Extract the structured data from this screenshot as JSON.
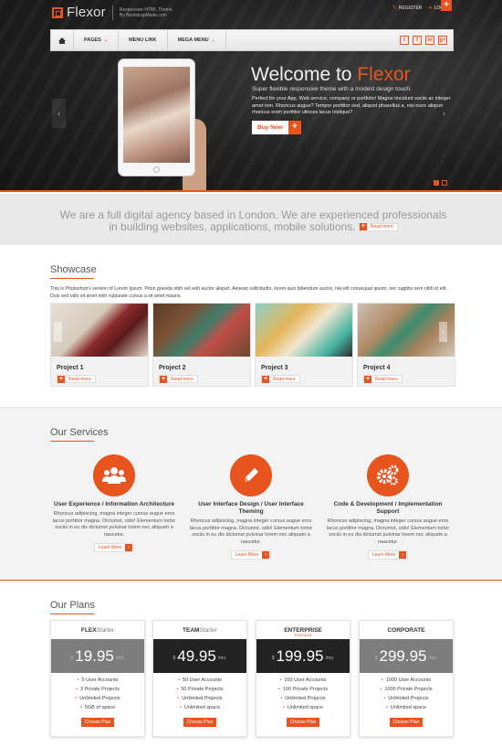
{
  "brand": {
    "name": "Flexor",
    "tagline_1": "Responsive HTML Theme",
    "tagline_2": "By BootstrapMade.com",
    "accent": "#e8541e"
  },
  "top_links": {
    "register": "REGISTER",
    "login": "LOGIN",
    "plus": "+"
  },
  "nav": {
    "items": [
      {
        "label": "PAGES",
        "has_caret": true
      },
      {
        "label": "MENU LINK",
        "has_caret": false
      },
      {
        "label": "MEGA MENU",
        "has_caret": true
      }
    ],
    "social": [
      "t",
      "f",
      "in",
      "g+"
    ]
  },
  "hero": {
    "title_prefix": "Welcome to ",
    "title_accent": "Flexor",
    "subtitle": "Super flexible responsive theme with a modest design touch.",
    "text": "Perfect for your App, Web service, company or portfolio! Magna tincidunt sociis ac integer amet non. Rhoncus augue? Tempor porttitor sed, aliquet phasellus a, nisi nunc aliquet rhoncus enim porttitor ultrices lacus tristique?",
    "button": "Buy Now",
    "button_plus": "+",
    "prev": "‹",
    "next": "›"
  },
  "band": {
    "text": "We are a full digital agency based in London. We are experienced professionals in building websites, applications, mobile solutions.",
    "read_more": "Read more"
  },
  "showcase": {
    "title": "Showcase",
    "text": "This is Photoshop's version of Lorem Ipsum. Proin gravida nibh vel velit auctor aliquet. Aenean sollicitudin, lorem quis bibendum auctor, nisi elit consequat ipsum, nec sagittis sem nibh id elit. Duis sed odio sit amet nibh vulputate cursus a sit amet mauris.",
    "projects": [
      {
        "name": "Project 1",
        "read_more": "Read more"
      },
      {
        "name": "Project 2",
        "read_more": "Read more"
      },
      {
        "name": "Project 3",
        "read_more": "Read more"
      },
      {
        "name": "Project 4",
        "read_more": "Read more"
      }
    ]
  },
  "services": {
    "title": "Our Services",
    "items": [
      {
        "title": "User Experience / Information Architecture",
        "text": "Rhoncus adipiscing, magna integer cursus augue eros lacus porttitor magna. Dictumst, odio! Elementum tortor sociis in eu dis dictumst pulvinar lorem nec aliquam a nascetur.",
        "button": "Learn More",
        "icon": "users-icon"
      },
      {
        "title": "User Interface Design / User Interface Theming",
        "text": "Rhoncus adipiscing, magna integer cursus augue eros lacus porttitor magna. Dictumst, odio! Elementum tortor sociis in eu dis dictumst pulvinar lorem nec aliquam a nascetur.",
        "button": "Learn More",
        "icon": "pencil-icon"
      },
      {
        "title": "Code & Development / Implementation Support",
        "text": "Rhoncus adipiscing, magna integer cursus augue eros lacus porttitor magna. Dictumst, odio! Elementum tortor sociis in eu dis dictumst pulvinar lorem nec aliquam a nascetur.",
        "button": "Learn More",
        "icon": "gears-icon"
      }
    ]
  },
  "plans": {
    "title": "Our Plans",
    "items": [
      {
        "name": "FLEX",
        "suffix": "Starter",
        "popular": "",
        "currency": "$",
        "price": "19.95",
        "per": "/mo.",
        "features": [
          "5 User Accounts",
          "3 Private Projects",
          "Unlimited Projects",
          "5GB of space"
        ],
        "button": "Choose Plan"
      },
      {
        "name": "TEAM",
        "suffix": "Starter",
        "popular": "",
        "currency": "$",
        "price": "49.95",
        "per": "/mo.",
        "features": [
          "50 User Accounts",
          "50 Private Projects",
          "Unlimited Projects",
          "Unlimited space"
        ],
        "button": "Choose Plan"
      },
      {
        "name": "ENTERPRISE",
        "suffix": "",
        "popular": "POPULAR",
        "currency": "$",
        "price": "199.95",
        "per": "/mo.",
        "features": [
          "100 User Accounts",
          "100 Private Projects",
          "Unlimited Projects",
          "Unlimited space"
        ],
        "button": "Choose Plan"
      },
      {
        "name": "CORPORATE",
        "suffix": "",
        "popular": "",
        "currency": "$",
        "price": "299.95",
        "per": "/mo.",
        "features": [
          "1000 User Accounts",
          "1000 Private Projects",
          "Unlimited Projects",
          "Unlimited space"
        ],
        "button": "Choose Plan"
      }
    ]
  }
}
